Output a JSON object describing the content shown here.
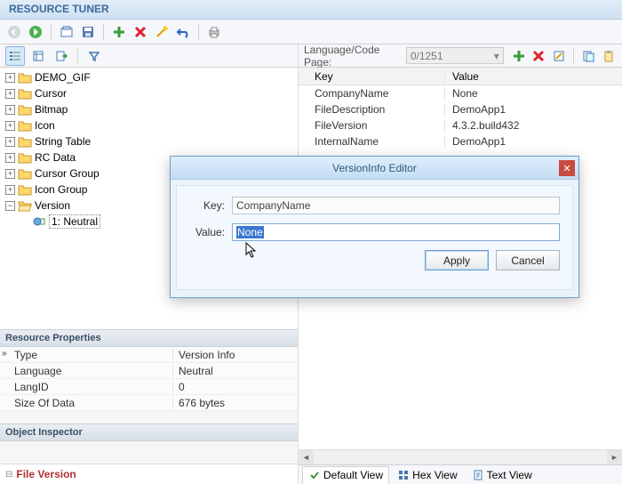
{
  "app": {
    "title": "RESOURCE TUNER"
  },
  "tree": {
    "items": [
      {
        "label": "DEMO_GIF",
        "expandable": true,
        "open": false
      },
      {
        "label": "Cursor",
        "expandable": true,
        "open": false
      },
      {
        "label": "Bitmap",
        "expandable": true,
        "open": false
      },
      {
        "label": "Icon",
        "expandable": true,
        "open": false
      },
      {
        "label": "String Table",
        "expandable": true,
        "open": false
      },
      {
        "label": "RC Data",
        "expandable": true,
        "open": false
      },
      {
        "label": "Cursor Group",
        "expandable": true,
        "open": false
      },
      {
        "label": "Icon Group",
        "expandable": true,
        "open": false
      },
      {
        "label": "Version",
        "expandable": true,
        "open": true
      }
    ],
    "version_child": {
      "label": "1: Neutral",
      "selected": true
    }
  },
  "props": {
    "header": "Resource Properties",
    "rows": [
      {
        "k": "Type",
        "v": "Version Info"
      },
      {
        "k": "Language",
        "v": "Neutral"
      },
      {
        "k": "LangID",
        "v": "0"
      },
      {
        "k": "Size Of Data",
        "v": "676 bytes"
      }
    ]
  },
  "inspector": {
    "header": "Object Inspector"
  },
  "file_version": {
    "label": "File Version"
  },
  "lang": {
    "label": "Language/Code Page:",
    "value": "0/1251"
  },
  "kv": {
    "headers": {
      "key": "Key",
      "value": "Value"
    },
    "rows": [
      {
        "k": "CompanyName",
        "v": "None"
      },
      {
        "k": "FileDescription",
        "v": "DemoApp1"
      },
      {
        "k": "FileVersion",
        "v": "4.3.2.build432"
      },
      {
        "k": "InternalName",
        "v": "DemoApp1"
      }
    ]
  },
  "tabs": {
    "default": "Default View",
    "hex": "Hex View",
    "text": "Text View"
  },
  "dialog": {
    "title": "VersionInfo Editor",
    "key_label": "Key:",
    "key_value": "CompanyName",
    "value_label": "Value:",
    "value_value": "None",
    "apply": "Apply",
    "cancel": "Cancel"
  }
}
